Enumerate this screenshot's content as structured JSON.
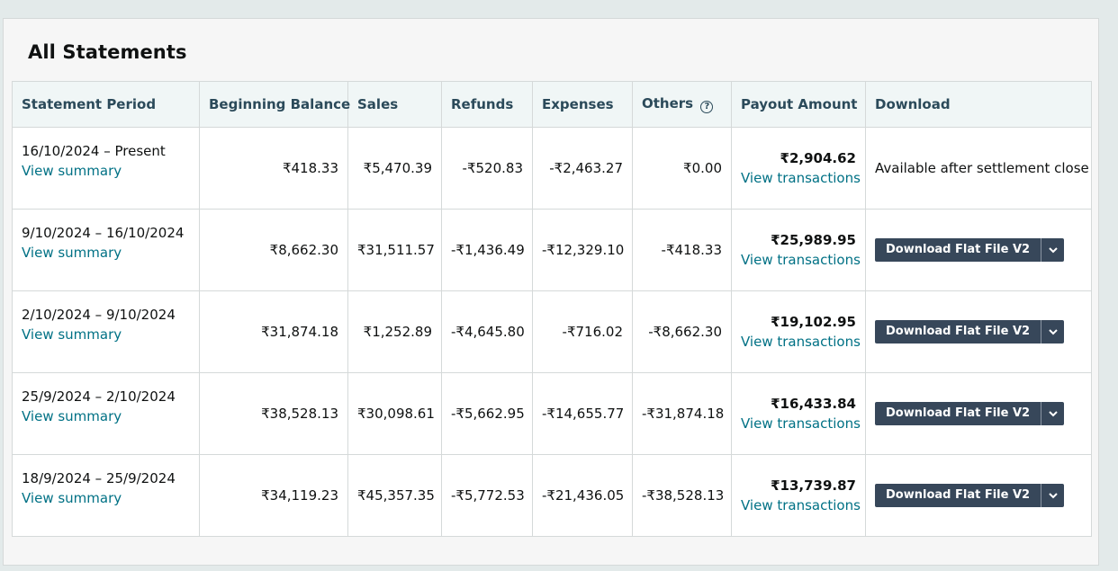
{
  "title": "All Statements",
  "columns": [
    "Statement Period",
    "Beginning Balance",
    "Sales",
    "Refunds",
    "Expenses",
    "Others",
    "Payout Amount",
    "Download"
  ],
  "info_icon": "?",
  "view_summary_label": "View summary",
  "view_transactions_label": "View transactions",
  "available_text": "Available after settlement close",
  "download_label": "Download Flat File V2",
  "rows": [
    {
      "period": "16/10/2024 – Present",
      "beginning": "₹418.33",
      "sales": "₹5,470.39",
      "refunds": "-₹520.83",
      "expenses": "-₹2,463.27",
      "others": "₹0.00",
      "payout": "₹2,904.62"
    },
    {
      "period": "9/10/2024 – 16/10/2024",
      "beginning": "₹8,662.30",
      "sales": "₹31,511.57",
      "refunds": "-₹1,436.49",
      "expenses": "-₹12,329.10",
      "others": "-₹418.33",
      "payout": "₹25,989.95"
    },
    {
      "period": "2/10/2024 – 9/10/2024",
      "beginning": "₹31,874.18",
      "sales": "₹1,252.89",
      "refunds": "-₹4,645.80",
      "expenses": "-₹716.02",
      "others": "-₹8,662.30",
      "payout": "₹19,102.95"
    },
    {
      "period": "25/9/2024 – 2/10/2024",
      "beginning": "₹38,528.13",
      "sales": "₹30,098.61",
      "refunds": "-₹5,662.95",
      "expenses": "-₹14,655.77",
      "others": "-₹31,874.18",
      "payout": "₹16,433.84"
    },
    {
      "period": "18/9/2024 – 25/9/2024",
      "beginning": "₹34,119.23",
      "sales": "₹45,357.35",
      "refunds": "-₹5,772.53",
      "expenses": "-₹21,436.05",
      "others": "-₹38,528.13",
      "payout": "₹13,739.87"
    }
  ]
}
